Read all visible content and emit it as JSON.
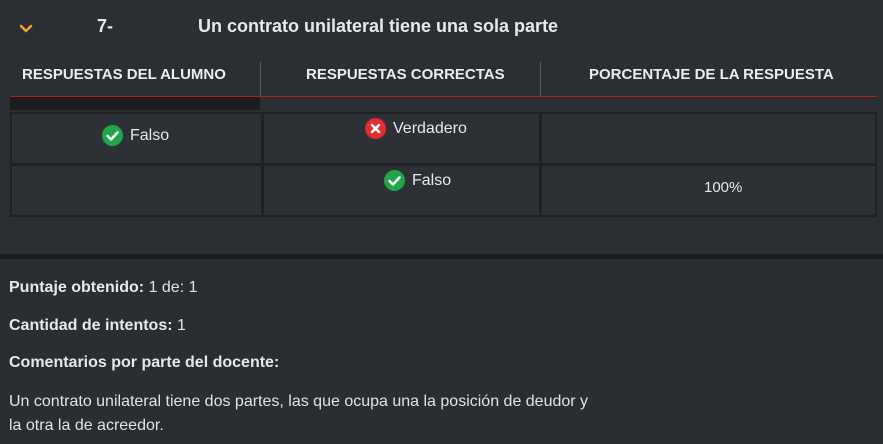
{
  "question": {
    "number": "7-",
    "text": "Un contrato unilateral tiene una sola parte"
  },
  "table": {
    "headers": [
      "RESPUESTAS DEL ALUMNO",
      "RESPUESTAS CORRECTAS",
      "PORCENTAJE DE LA RESPUESTA"
    ],
    "rows": [
      {
        "student": {
          "label": "Falso",
          "icon": "check-circle-icon"
        },
        "correct": {
          "label": "Verdadero",
          "icon": "x-circle-icon"
        },
        "percentage": ""
      },
      {
        "student": {
          "label": "",
          "icon": ""
        },
        "correct": {
          "label": "Falso",
          "icon": "check-circle-icon"
        },
        "percentage": "100%"
      }
    ]
  },
  "summary": {
    "score_label": "Puntaje obtenido:",
    "score_value": "1 de: 1",
    "attempts_label": "Cantidad de intentos:",
    "attempts_value": "1",
    "comments_label": "Comentarios por parte del docente:",
    "comment_line1": "Un contrato unilateral tiene dos partes, las que ocupa una la posición de deudor y",
    "comment_line2": "la otra la de acreedor."
  },
  "colors": {
    "accent_orange": "#f0a02c",
    "check_green": "#1fa54a",
    "error_red": "#e22b33",
    "header_underline": "#b02121"
  }
}
